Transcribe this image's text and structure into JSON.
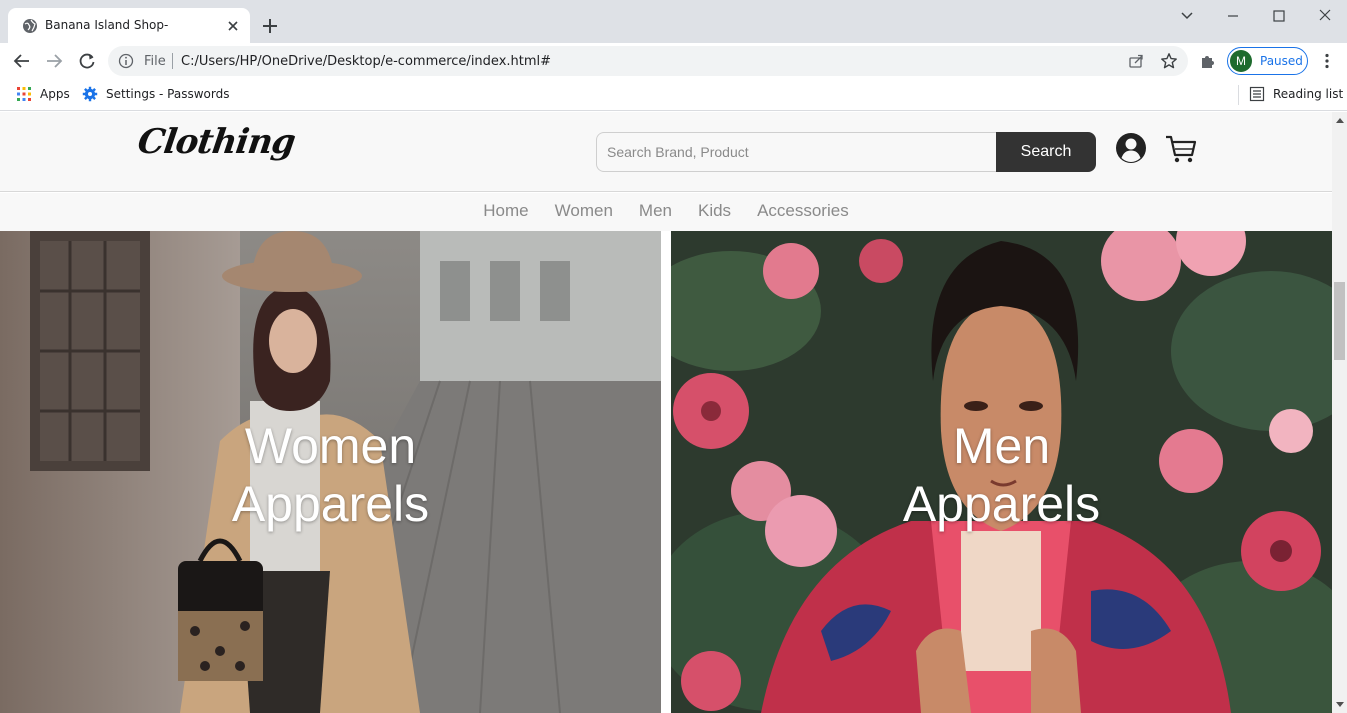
{
  "browser": {
    "tab_title": "Banana Island Shop-",
    "url_scheme": "File",
    "url": "C:/Users/HP/OneDrive/Desktop/e-commerce/index.html#",
    "profile_initial": "M",
    "profile_status": "Paused",
    "bookmarks": [
      {
        "label": "Apps",
        "icon": "apps-grid-icon"
      },
      {
        "label": "Settings - Passwords",
        "icon": "gear-icon"
      }
    ],
    "reading_list_label": "Reading list"
  },
  "site": {
    "logo_text": "Clothing",
    "search": {
      "placeholder": "Search Brand, Product",
      "button_label": "Search"
    },
    "nav": [
      "Home",
      "Women",
      "Men",
      "Kids",
      "Accessories"
    ],
    "hero": {
      "women": {
        "line1": "Women",
        "line2": "Apparels"
      },
      "men": {
        "line1": "Men",
        "line2": "Apparels"
      }
    }
  },
  "colors": {
    "chrome_tabbar": "#dee1e6",
    "search_button": "#333333",
    "nav_text": "#8a8a8a",
    "profile_accent": "#1a73e8"
  }
}
